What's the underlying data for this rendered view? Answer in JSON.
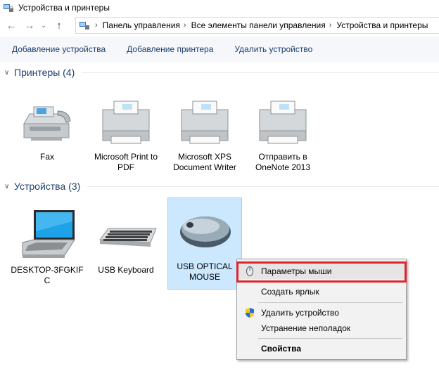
{
  "window": {
    "title": "Устройства и принтеры"
  },
  "address_bar": {
    "breadcrumbs": [
      "Панель управления",
      "Все элементы панели управления",
      "Устройства и принтеры"
    ]
  },
  "toolbar": {
    "add_device": "Добавление устройства",
    "add_printer": "Добавление принтера",
    "remove_device": "Удалить устройство"
  },
  "groups": {
    "printers": {
      "title": "Принтеры (4)",
      "items": [
        "Fax",
        "Microsoft Print to PDF",
        "Microsoft XPS Document Writer",
        "Отправить в OneNote 2013"
      ]
    },
    "devices": {
      "title": "Устройства (3)",
      "items": [
        "DESKTOP-3FGKIF C",
        "USB Keyboard",
        "USB OPTICAL MOUSE"
      ]
    }
  },
  "context_menu": {
    "items": [
      "Параметры мыши",
      "Создать ярлык",
      "Удалить устройство",
      "Устранение неполадок",
      "Свойства"
    ]
  },
  "colors": {
    "accent": "#1e3f6b",
    "selection": "#cce8ff",
    "highlight_border": "#e0242b"
  }
}
